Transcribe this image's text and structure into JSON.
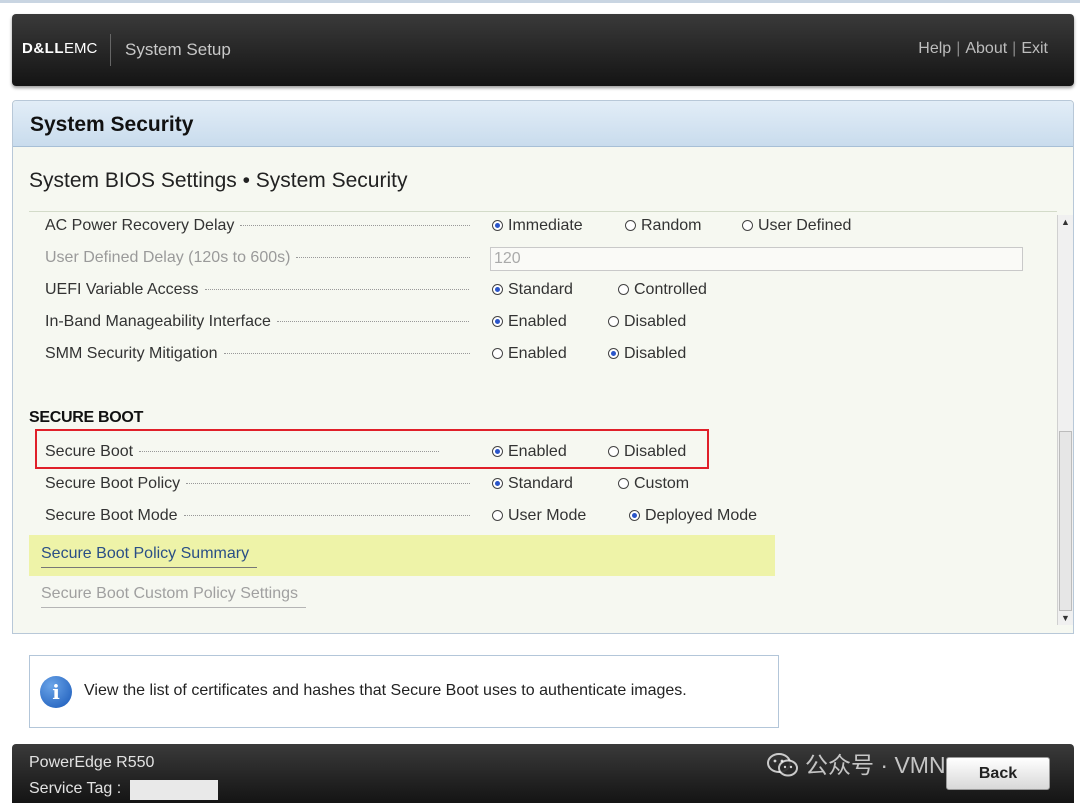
{
  "header": {
    "logo": {
      "dell": "D&LL",
      "emc": "EMC"
    },
    "title": "System Setup",
    "links": {
      "help": "Help",
      "about": "About",
      "exit": "Exit",
      "separator": "|"
    }
  },
  "section": {
    "title": "System Security",
    "breadcrumb": "System BIOS Settings • System Security"
  },
  "settings": {
    "ac_power_recovery_delay": {
      "label": "AC Power Recovery Delay",
      "options": [
        "Immediate",
        "Random",
        "User Defined"
      ],
      "selected": "Immediate"
    },
    "user_defined_delay": {
      "label": "User Defined Delay (120s to 600s)",
      "value": "120",
      "enabled": false
    },
    "uefi_variable_access": {
      "label": "UEFI Variable Access",
      "options": [
        "Standard",
        "Controlled"
      ],
      "selected": "Standard"
    },
    "in_band_manageability": {
      "label": "In-Band Manageability Interface",
      "options": [
        "Enabled",
        "Disabled"
      ],
      "selected": "Enabled"
    },
    "smm_security_mitigation": {
      "label": "SMM Security Mitigation",
      "options": [
        "Enabled",
        "Disabled"
      ],
      "selected": "Disabled"
    }
  },
  "secure_boot": {
    "heading": "SECURE BOOT",
    "secure_boot": {
      "label": "Secure Boot",
      "options": [
        "Enabled",
        "Disabled"
      ],
      "selected": "Enabled"
    },
    "secure_boot_policy": {
      "label": "Secure Boot Policy",
      "options": [
        "Standard",
        "Custom"
      ],
      "selected": "Standard"
    },
    "secure_boot_mode": {
      "label": "Secure Boot Mode",
      "options": [
        "User Mode",
        "Deployed Mode"
      ],
      "selected": "Deployed Mode"
    },
    "links": {
      "policy_summary": "Secure Boot Policy Summary",
      "custom_policy_settings": "Secure Boot Custom Policy Settings"
    }
  },
  "help_text": "View the list of certificates and hashes that Secure Boot uses to authenticate images.",
  "footer": {
    "model": "PowerEdge R550",
    "service_tag_label": "Service Tag :",
    "watermark": "公众号 · VMNote",
    "back_label": "Back"
  },
  "icons": {
    "info": "info-icon",
    "wechat": "wechat-icon",
    "scroll_up": "triangle-up-icon",
    "scroll_down": "triangle-down-icon"
  },
  "colors": {
    "accent_radio": "#2a55c9",
    "highlight_row": "#eef3a8",
    "annotation_box": "#e0202a",
    "link": "#2a4f86"
  }
}
